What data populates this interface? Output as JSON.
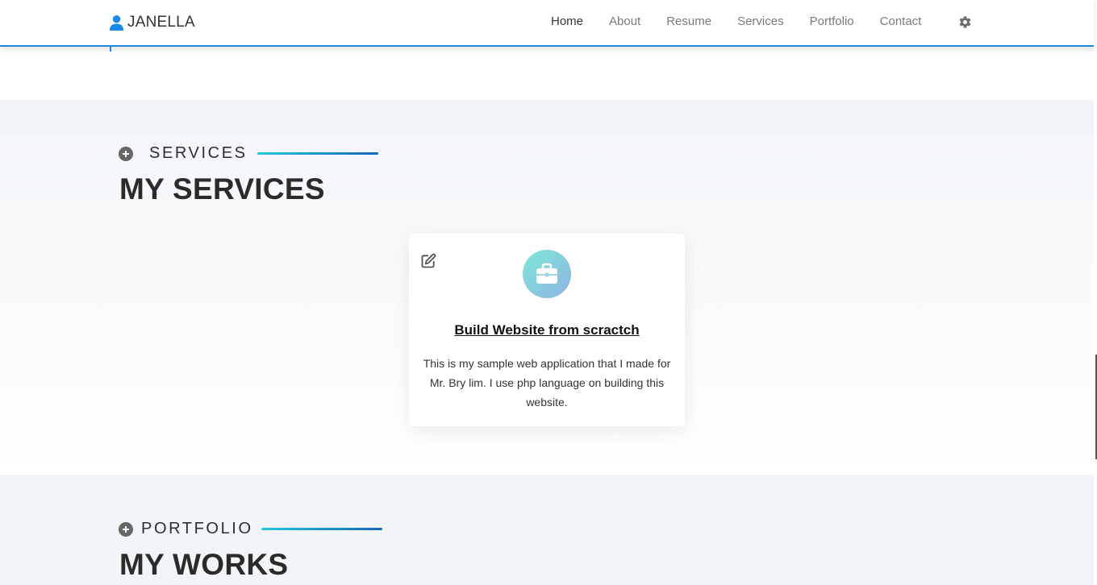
{
  "navbar": {
    "brand": "JANELLA",
    "links": [
      "Home",
      "About",
      "Resume",
      "Services",
      "Portfolio",
      "Contact"
    ],
    "active": "Home",
    "accent_color": "#1e88e5"
  },
  "services": {
    "eyebrow": "SERVICES",
    "heading": "MY SERVICES",
    "card": {
      "icon": "briefcase-icon",
      "title": "Build Website from scractch",
      "description": "This is my sample web application that I made for Mr. Bry lim. I use php language on building this website."
    }
  },
  "portfolio": {
    "eyebrow": "PORTFOLIO",
    "heading": "MY WORKS"
  }
}
